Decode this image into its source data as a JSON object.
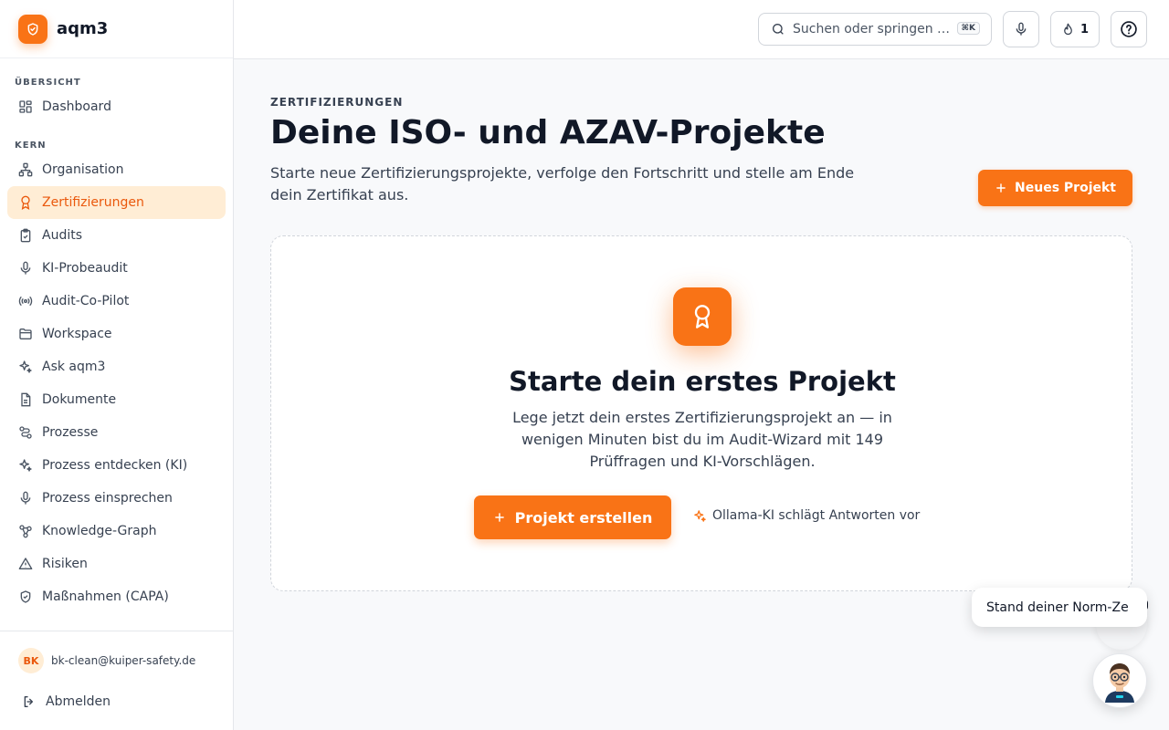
{
  "app": {
    "name": "aqm3"
  },
  "sidebar": {
    "sections": [
      {
        "label": "ÜBERSICHT"
      },
      {
        "label": "KERN"
      }
    ],
    "items": [
      {
        "label": "Dashboard",
        "icon": "dashboard-icon"
      },
      {
        "label": "Organisation",
        "icon": "org-chart-icon"
      },
      {
        "label": "Zertifizierungen",
        "icon": "award-icon",
        "active": true
      },
      {
        "label": "Audits",
        "icon": "clipboard-check-icon"
      },
      {
        "label": "KI-Probeaudit",
        "icon": "mic-icon"
      },
      {
        "label": "Audit-Co-Pilot",
        "icon": "radio-icon"
      },
      {
        "label": "Workspace",
        "icon": "folder-icon"
      },
      {
        "label": "Ask aqm3",
        "icon": "sparkles-icon"
      },
      {
        "label": "Dokumente",
        "icon": "document-icon"
      },
      {
        "label": "Prozesse",
        "icon": "route-icon"
      },
      {
        "label": "Prozess entdecken (KI)",
        "icon": "sparkles-icon"
      },
      {
        "label": "Prozess einsprechen",
        "icon": "mic-icon"
      },
      {
        "label": "Knowledge-Graph",
        "icon": "network-icon"
      },
      {
        "label": "Risiken",
        "icon": "warning-icon"
      },
      {
        "label": "Maßnahmen (CAPA)",
        "icon": "shield-check-icon"
      }
    ],
    "user": {
      "initials": "BK",
      "email": "bk-clean@kuiper-safety.de"
    },
    "logout_label": "Abmelden"
  },
  "topbar": {
    "search_placeholder": "Suchen oder springen …",
    "search_shortcut": "⌘K",
    "streak_count": "1"
  },
  "page": {
    "eyebrow": "ZERTIFIZIERUNGEN",
    "title": "Deine ISO- und AZAV-Projekte",
    "subtitle": "Starte neue Zertifizierungsprojekte, verfolge den Fortschritt und stelle am Ende dein Zertifikat aus.",
    "new_project_label": "Neues Projekt"
  },
  "empty_state": {
    "title": "Starte dein erstes Projekt",
    "text": "Lege jetzt dein erstes Zertifizierungsprojekt an — in wenigen Minuten bist du im Audit-Wizard mit 149 Prüffragen und KI-Vorschlägen.",
    "create_label": "Projekt erstellen",
    "ai_hint": "Ollama-KI schlägt Antworten vor"
  },
  "assistant": {
    "bubble_text": "Stand deiner Norm-Ze"
  },
  "colors": {
    "accent": "#f97316",
    "accent_light": "#ffedd5",
    "text_dark": "#111827"
  }
}
